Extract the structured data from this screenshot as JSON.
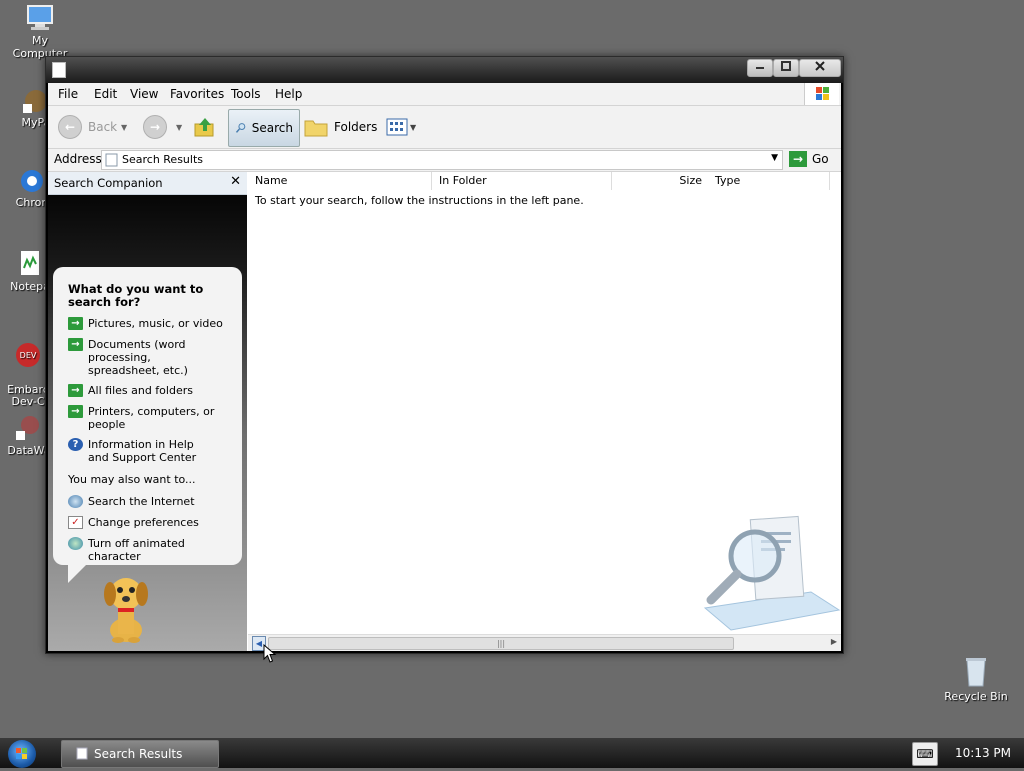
{
  "desktop": {
    "icons": [
      {
        "label": "My Computer"
      },
      {
        "label": "MyPa"
      },
      {
        "label": "Chron"
      },
      {
        "label": "Notepa"
      },
      {
        "label": "Embarc\nDev-C"
      },
      {
        "label": "DataWa"
      },
      {
        "label": "Recycle Bin"
      }
    ]
  },
  "window": {
    "menu": [
      "File",
      "Edit",
      "View",
      "Favorites",
      "Tools",
      "Help"
    ],
    "toolbar": {
      "back_label": "Back",
      "search_label": "Search",
      "folders_label": "Folders"
    },
    "address": {
      "label": "Address",
      "value": "Search Results",
      "go_label": "Go"
    },
    "search_companion": {
      "title": "Search Companion",
      "question": "What do you want to search for?",
      "options": [
        {
          "label": "Pictures, music, or video",
          "icon": "green-arrow-icon"
        },
        {
          "label": "Documents (word processing, spreadsheet, etc.)",
          "icon": "green-arrow-icon"
        },
        {
          "label": "All files and folders",
          "icon": "green-arrow-icon"
        },
        {
          "label": "Printers, computers, or people",
          "icon": "green-arrow-icon"
        },
        {
          "label": "Information in Help and Support Center",
          "icon": "help-icon"
        }
      ],
      "also_label": "You may also want to...",
      "also": [
        {
          "label": "Search the Internet",
          "icon": "internet-search-icon"
        },
        {
          "label": "Change preferences",
          "icon": "preferences-icon"
        },
        {
          "label": "Turn off animated character",
          "icon": "character-icon"
        }
      ]
    },
    "results": {
      "columns": [
        "Name",
        "In Folder",
        "Size",
        "Type"
      ],
      "message": "To start your search, follow the instructions in the left pane."
    }
  },
  "taskbar": {
    "task_label": "Search Results",
    "clock": "10:13 PM"
  }
}
